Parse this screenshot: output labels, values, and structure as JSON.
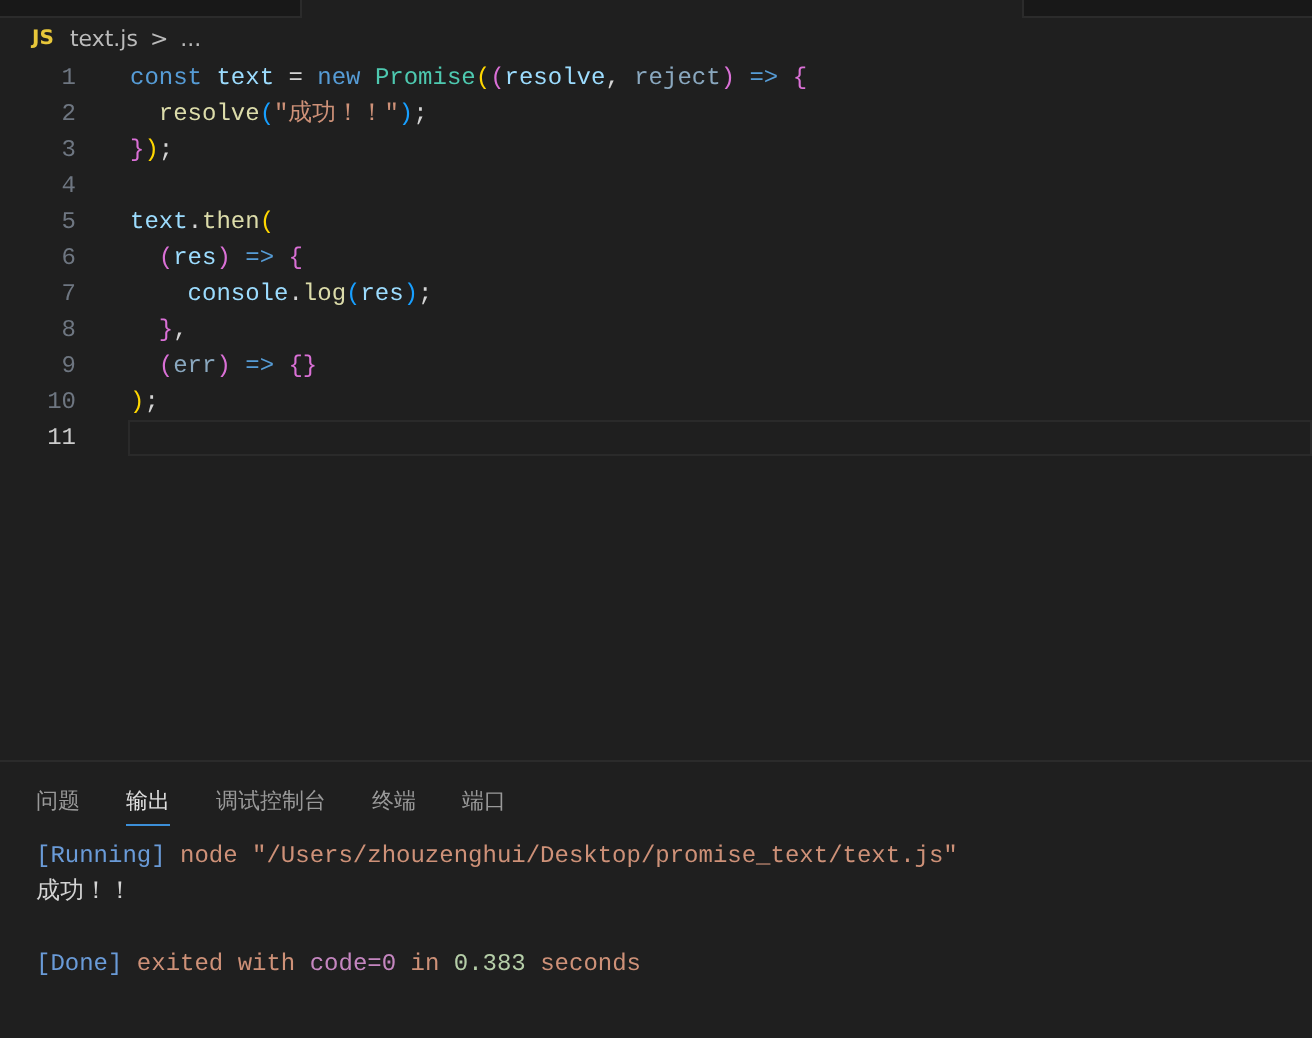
{
  "breadcrumb": {
    "badge": "JS",
    "file": "text.js",
    "separator": ">",
    "rest": "..."
  },
  "editor": {
    "lines": [
      {
        "number": "1",
        "current": false,
        "tokens": [
          {
            "kind": "keyword",
            "text": "const "
          },
          {
            "kind": "variable",
            "text": "text"
          },
          {
            "kind": "plain",
            "text": " = "
          },
          {
            "kind": "keyword",
            "text": "new "
          },
          {
            "kind": "class",
            "text": "Promise"
          },
          {
            "kind": "bracket1",
            "text": "("
          },
          {
            "kind": "bracket2",
            "text": "("
          },
          {
            "kind": "param",
            "text": "resolve"
          },
          {
            "kind": "plain",
            "text": ", "
          },
          {
            "kind": "dim",
            "text": "reject"
          },
          {
            "kind": "bracket2",
            "text": ") "
          },
          {
            "kind": "keyword",
            "text": "=> "
          },
          {
            "kind": "bracket2",
            "text": "{"
          }
        ]
      },
      {
        "number": "2",
        "current": false,
        "tokens": [
          {
            "kind": "function",
            "text": "  resolve"
          },
          {
            "kind": "bracket3",
            "text": "("
          },
          {
            "kind": "string",
            "text": "\"成功！！\""
          },
          {
            "kind": "bracket3",
            "text": ")"
          },
          {
            "kind": "plain",
            "text": ";"
          }
        ]
      },
      {
        "number": "3",
        "current": false,
        "tokens": [
          {
            "kind": "bracket2",
            "text": "}"
          },
          {
            "kind": "bracket1",
            "text": ")"
          },
          {
            "kind": "plain",
            "text": ";"
          }
        ]
      },
      {
        "number": "4",
        "current": false
      },
      {
        "number": "5",
        "current": false,
        "tokens": [
          {
            "kind": "variable",
            "text": "text"
          },
          {
            "kind": "plain",
            "text": "."
          },
          {
            "kind": "function",
            "text": "then"
          },
          {
            "kind": "bracket1",
            "text": "("
          }
        ]
      },
      {
        "number": "6",
        "current": false,
        "tokens": [
          {
            "kind": "bracket2",
            "text": "  ("
          },
          {
            "kind": "param",
            "text": "res"
          },
          {
            "kind": "bracket2",
            "text": ") "
          },
          {
            "kind": "keyword",
            "text": "=> "
          },
          {
            "kind": "bracket2",
            "text": "{"
          }
        ]
      },
      {
        "number": "7",
        "current": false,
        "tokens": [
          {
            "kind": "variable",
            "text": "    console"
          },
          {
            "kind": "plain",
            "text": "."
          },
          {
            "kind": "function",
            "text": "log"
          },
          {
            "kind": "bracket3",
            "text": "("
          },
          {
            "kind": "param",
            "text": "res"
          },
          {
            "kind": "bracket3",
            "text": ")"
          },
          {
            "kind": "plain",
            "text": ";"
          }
        ]
      },
      {
        "number": "8",
        "current": false,
        "tokens": [
          {
            "kind": "bracket2",
            "text": "  }"
          },
          {
            "kind": "plain",
            "text": ","
          }
        ]
      },
      {
        "number": "9",
        "current": false,
        "tokens": [
          {
            "kind": "bracket2",
            "text": "  ("
          },
          {
            "kind": "dim",
            "text": "err"
          },
          {
            "kind": "bracket2",
            "text": ") "
          },
          {
            "kind": "keyword",
            "text": "=> "
          },
          {
            "kind": "bracket2",
            "text": "{}"
          }
        ]
      },
      {
        "number": "10",
        "current": false,
        "tokens": [
          {
            "kind": "bracket1",
            "text": ")"
          },
          {
            "kind": "plain",
            "text": ";"
          }
        ]
      },
      {
        "number": "11",
        "current": true
      }
    ]
  },
  "panel": {
    "tabs": [
      {
        "label": "问题",
        "selected": false
      },
      {
        "label": "输出",
        "selected": true
      },
      {
        "label": "调试控制台",
        "selected": false
      },
      {
        "label": "终端",
        "selected": false
      },
      {
        "label": "端口",
        "selected": false
      }
    ],
    "output_blocks": [
      {
        "lines": [
          {
            "tokens": [
              {
                "kind": "tag",
                "text": "[Running]"
              },
              {
                "kind": "string",
                "text": " node \"/Users/zhouzenghui/Desktop/promise_text/text.js\""
              }
            ]
          },
          {
            "tokens": [
              {
                "kind": "plain",
                "text": "成功！！"
              }
            ]
          }
        ]
      },
      {
        "lines": [
          {
            "tokens": [
              {
                "kind": "tag",
                "text": "[Done]"
              },
              {
                "kind": "string",
                "text": " exited with "
              },
              {
                "kind": "purple",
                "text": "code=0"
              },
              {
                "kind": "string",
                "text": " in "
              },
              {
                "kind": "number",
                "text": "0.383"
              },
              {
                "kind": "string",
                "text": " seconds"
              }
            ]
          }
        ]
      }
    ]
  }
}
